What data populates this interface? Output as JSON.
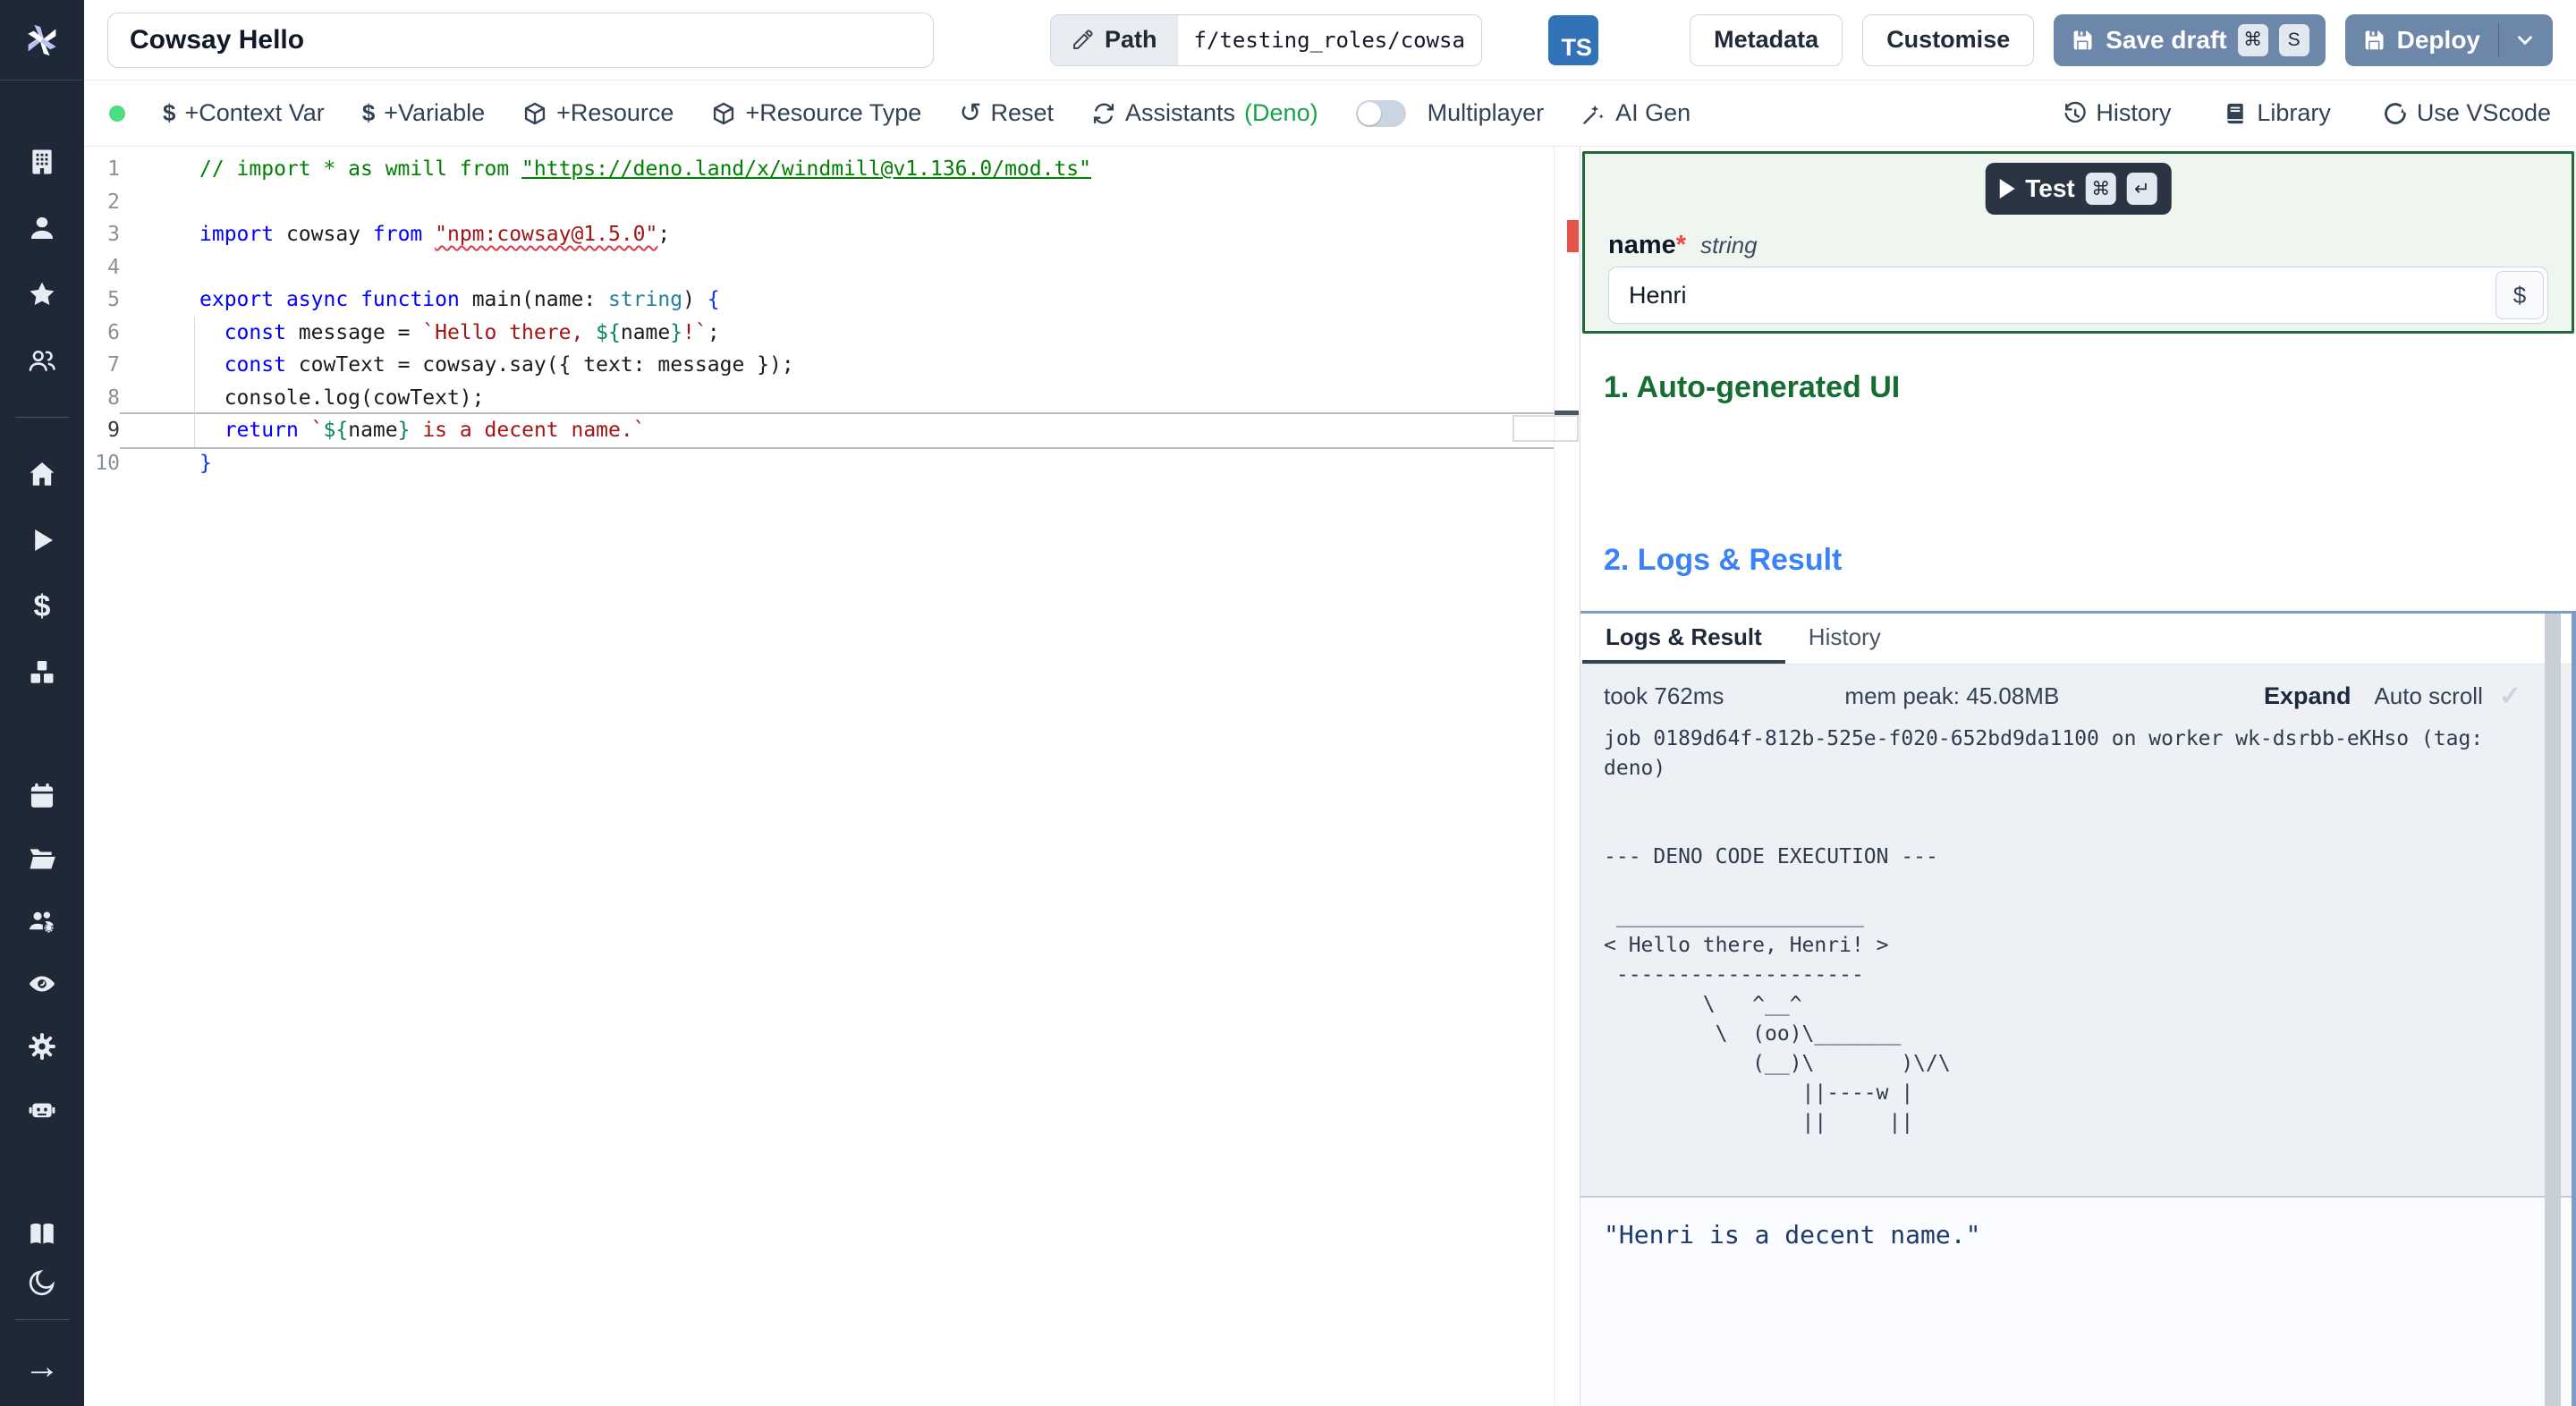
{
  "header": {
    "title": "Cowsay Hello",
    "path_label": "Path",
    "path_value": "f/testing_roles/cowsa",
    "lang_badge": "TS",
    "metadata": "Metadata",
    "customise": "Customise",
    "save_draft": "Save draft",
    "save_kbd": [
      "⌘",
      "S"
    ],
    "deploy": "Deploy"
  },
  "toolbar": {
    "context_var": "+Context Var",
    "variable": "+Variable",
    "resource": "+Resource",
    "resource_type": "+Resource Type",
    "reset": "Reset",
    "assistants": "Assistants",
    "assistants_lang": "(Deno)",
    "multiplayer": "Multiplayer",
    "ai_gen": "AI Gen",
    "history": "History",
    "library": "Library",
    "use_vscode": "Use VScode"
  },
  "icons": {
    "dollar": "$",
    "reset": "↺",
    "check": "✓",
    "arrow_right": "→"
  },
  "editor": {
    "lines": [
      {
        "n": "1",
        "segs": [
          [
            "// import * as wmill from ",
            "c-comment"
          ],
          [
            "\"https://deno.land/x/windmill@v1.136.0/mod.ts\"",
            "c-comment c-link"
          ]
        ]
      },
      {
        "n": "2",
        "segs": []
      },
      {
        "n": "3",
        "segs": [
          [
            "import",
            "c-kw"
          ],
          [
            " cowsay ",
            "c-plain"
          ],
          [
            "from",
            "c-kw"
          ],
          [
            " ",
            "c-plain"
          ],
          [
            "\"npm:cowsay@1.5.0\"",
            "c-str c-squiggle"
          ],
          [
            ";",
            "c-plain"
          ]
        ]
      },
      {
        "n": "4",
        "segs": []
      },
      {
        "n": "5",
        "segs": [
          [
            "export",
            "c-kw"
          ],
          [
            " ",
            "c-plain"
          ],
          [
            "async",
            "c-kw"
          ],
          [
            " ",
            "c-plain"
          ],
          [
            "function",
            "c-kw"
          ],
          [
            " main(name: ",
            "c-plain"
          ],
          [
            "string",
            "c-type"
          ],
          [
            ") ",
            "c-plain"
          ],
          [
            "{",
            "c-bracket"
          ]
        ]
      },
      {
        "n": "6",
        "segs": [
          [
            "  ",
            "c-plain"
          ],
          [
            "const",
            "c-kw"
          ],
          [
            " message = ",
            "c-plain"
          ],
          [
            "`Hello there, ",
            "c-str"
          ],
          [
            "${",
            "c-tpl"
          ],
          [
            "name",
            "c-plain"
          ],
          [
            "}",
            "c-tpl"
          ],
          [
            "!`",
            "c-str"
          ],
          [
            ";",
            "c-plain"
          ]
        ]
      },
      {
        "n": "7",
        "segs": [
          [
            "  ",
            "c-plain"
          ],
          [
            "const",
            "c-kw"
          ],
          [
            " cowText = cowsay.say({ text: message });",
            "c-plain"
          ]
        ]
      },
      {
        "n": "8",
        "segs": [
          [
            "  console.log(cowText);",
            "c-plain"
          ]
        ]
      },
      {
        "n": "9",
        "current": true,
        "segs": [
          [
            "  ",
            "c-plain"
          ],
          [
            "return",
            "c-kw"
          ],
          [
            " ",
            "c-plain"
          ],
          [
            "`",
            "c-str"
          ],
          [
            "${",
            "c-tpl"
          ],
          [
            "name",
            "c-plain"
          ],
          [
            "}",
            "c-tpl"
          ],
          [
            " is a decent name.`",
            "c-str"
          ]
        ]
      },
      {
        "n": "10",
        "segs": [
          [
            "}",
            "c-bracket"
          ]
        ]
      }
    ]
  },
  "right_panel": {
    "test": "Test",
    "test_kbd": [
      "⌘",
      "↵"
    ],
    "arg": {
      "name": "name",
      "required": "*",
      "type": "string",
      "value": "Henri",
      "dollar": "$"
    },
    "section1": "1. Auto-generated UI",
    "section2": "2. Logs & Result",
    "tabs": [
      "Logs & Result",
      "History"
    ],
    "stats": {
      "took": "took 762ms",
      "mem": "mem peak: 45.08MB",
      "expand": "Expand",
      "autoscroll": "Auto scroll"
    },
    "log_lines": [
      "job 0189d64f-812b-525e-f020-652bd9da1100 on worker wk-dsrbb-eKHso (tag:",
      "deno)",
      "",
      "",
      "--- DENO CODE EXECUTION ---",
      "",
      " ____________________",
      "< Hello there, Henri! >",
      " --------------------",
      "        \\   ^__^",
      "         \\  (oo)\\_______",
      "            (__)\\       )\\/\\",
      "                ||----w |",
      "                ||     ||"
    ],
    "result": "\"Henri is a decent name.\""
  },
  "colors": {
    "sidebar_bg": "#1e2836",
    "accent_save": "#6d87ab",
    "ts_badge": "#3273b8",
    "green_border": "#1f6b38",
    "green_bg": "#eff6f0",
    "section1": "#166d34",
    "section2": "#3b82f6",
    "logs_border": "#7e9cc4",
    "log_bg": "#edf1f6",
    "status_dot": "#4ade80",
    "deno_green": "#16a34a",
    "error_red": "#e5534b",
    "result_navy": "#1d3a6d"
  }
}
